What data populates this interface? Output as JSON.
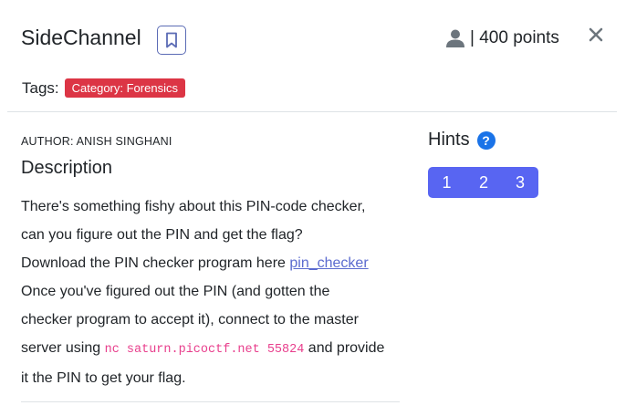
{
  "header": {
    "title": "SideChannel",
    "points_label": "| 400 points",
    "bookmark_icon": "bookmark-icon",
    "user_icon": "user-icon",
    "close_icon": "close-icon"
  },
  "tags": {
    "label": "Tags:",
    "items": [
      {
        "text": "Category: Forensics",
        "color": "#dc3545"
      }
    ]
  },
  "content": {
    "author": "AUTHOR: ANISH SINGHANI",
    "heading": "Description",
    "line1": "There's something fishy about this PIN-code checker,",
    "line2": "can you figure out the PIN and get the flag?",
    "line3_prefix": "Download the PIN checker program here ",
    "link_text": "pin_checker",
    "line4": "Once you've figured out the PIN (and gotten the",
    "line5": "checker program to accept it), connect to the master",
    "line6_prefix": "server using ",
    "code": "nc saturn.picoctf.net 55824",
    "line6_suffix": " and provide",
    "line7": "it the PIN to get your flag."
  },
  "hints": {
    "heading": "Hints",
    "help_icon": "?",
    "buttons": [
      "1",
      "2",
      "3"
    ],
    "accent": "#5865f2"
  }
}
